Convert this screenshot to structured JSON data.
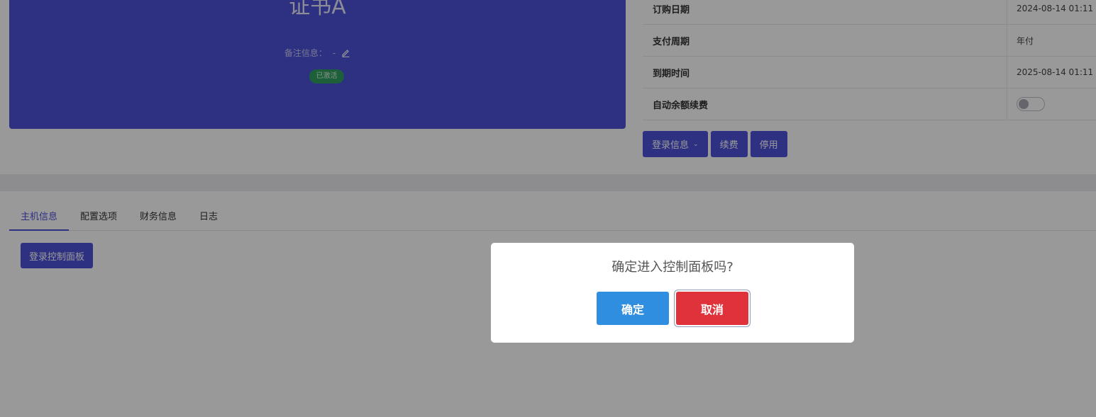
{
  "product": {
    "name": "证书A",
    "remark_label": "备注信息：",
    "remark_value": "-",
    "status": "已激活"
  },
  "info": {
    "rows": [
      {
        "label": "订购日期",
        "value": "2024-08-14 01:11"
      },
      {
        "label": "支付周期",
        "value": "年付"
      },
      {
        "label": "到期时间",
        "value": "2025-08-14 01:11"
      },
      {
        "label": "自动余额续费",
        "value": ""
      }
    ],
    "auto_renew_enabled": false
  },
  "actions": {
    "login_info": "登录信息",
    "renew": "续费",
    "disable": "停用"
  },
  "tabs": [
    {
      "label": "主机信息",
      "active": true
    },
    {
      "label": "配置选项",
      "active": false
    },
    {
      "label": "财务信息",
      "active": false
    },
    {
      "label": "日志",
      "active": false
    }
  ],
  "panel": {
    "login_button": "登录控制面板"
  },
  "dialog": {
    "message": "确定进入控制面板吗?",
    "confirm": "确定",
    "cancel": "取消"
  },
  "colors": {
    "primary": "#4d52d9",
    "success": "#2f9e5e",
    "confirm": "#2f8ee0",
    "danger": "#e0323a"
  }
}
